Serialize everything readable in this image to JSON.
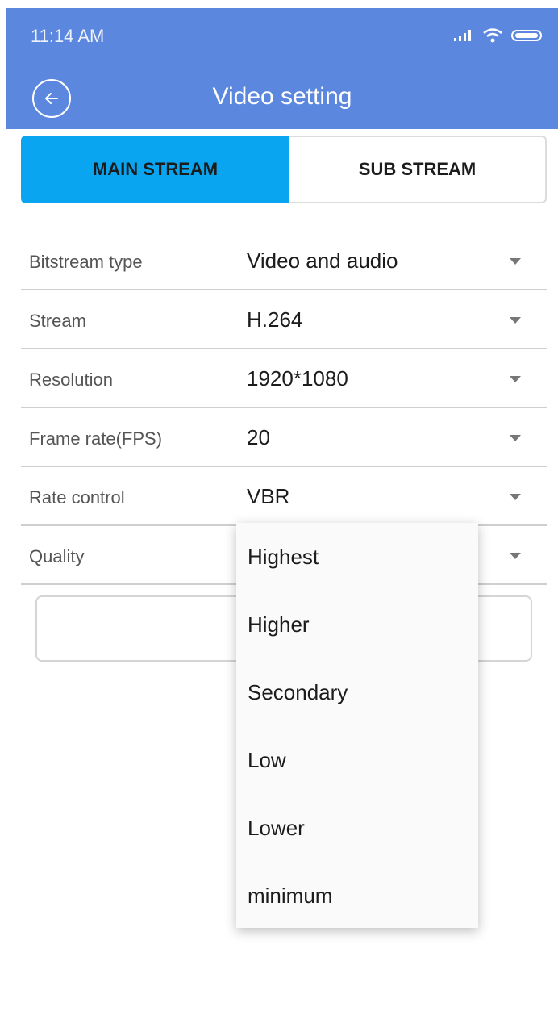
{
  "status_bar": {
    "time": "11:14 AM"
  },
  "header": {
    "title": "Video setting"
  },
  "tabs": [
    {
      "label": "MAIN STREAM",
      "active": true
    },
    {
      "label": "SUB STREAM",
      "active": false
    }
  ],
  "settings": [
    {
      "label": "Bitstream type",
      "value": "Video and audio"
    },
    {
      "label": "Stream",
      "value": "H.264"
    },
    {
      "label": "Resolution",
      "value": "1920*1080"
    },
    {
      "label": "Frame rate(FPS)",
      "value": "20"
    },
    {
      "label": "Rate control",
      "value": "VBR"
    },
    {
      "label": "Quality",
      "value": ""
    }
  ],
  "quality_dropdown": {
    "options": [
      "Highest",
      "Higher",
      "Secondary",
      "Low",
      "Lower",
      "minimum"
    ]
  },
  "colors": {
    "appbar": "#5b87df",
    "active_tab": "#0aa5f0"
  }
}
